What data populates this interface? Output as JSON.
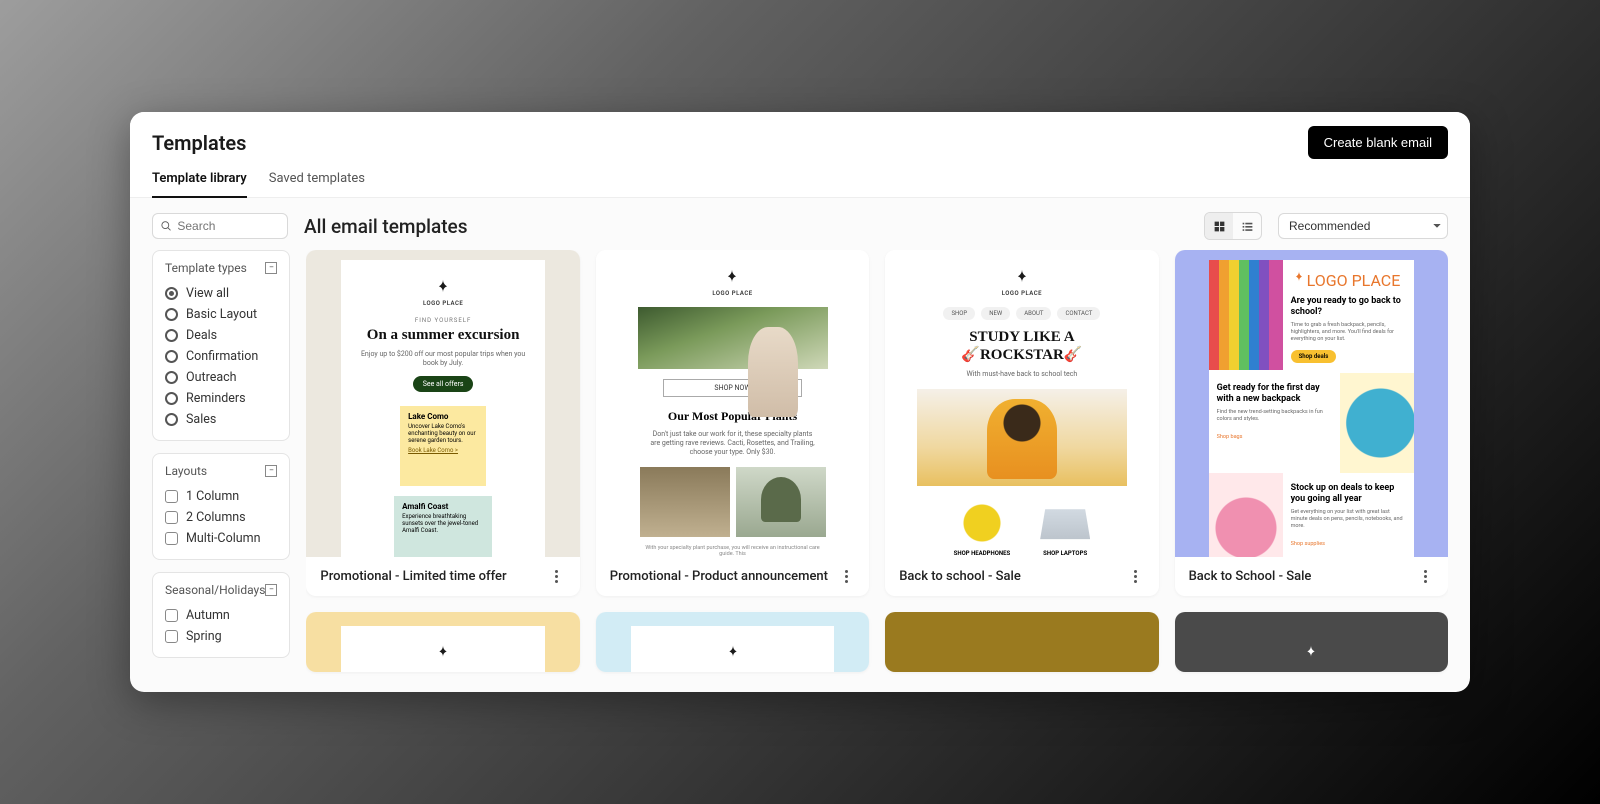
{
  "header": {
    "title": "Templates",
    "create_button": "Create blank email"
  },
  "tabs": [
    "Template library",
    "Saved templates"
  ],
  "active_tab": 0,
  "search": {
    "placeholder": "Search"
  },
  "heading": "All email templates",
  "view_mode": "grid",
  "sort": {
    "selected": "Recommended"
  },
  "filters": {
    "types": {
      "title": "Template types",
      "options": [
        "View all",
        "Basic Layout",
        "Deals",
        "Confirmation",
        "Outreach",
        "Reminders",
        "Sales"
      ],
      "selected": "View all"
    },
    "layouts": {
      "title": "Layouts",
      "options": [
        "1 Column",
        "2 Columns",
        "Multi-Column"
      ]
    },
    "seasonal": {
      "title": "Seasonal/Holidays",
      "options": [
        "Autumn",
        "Spring"
      ]
    }
  },
  "logo_text": "LOGO PLACE",
  "cards": [
    {
      "title": "Promotional - Limited time offer",
      "tag": "FIND YOURSELF",
      "headline": "On a summer excursion",
      "sub": "Enjoy up to $200 off our most popular trips when you book by July.",
      "cta": "See all offers",
      "feat1_title": "Lake Como",
      "feat1_body": "Uncover Lake Como's enchanting beauty on our serene garden tours.",
      "feat1_link": "Book Lake Como  >",
      "feat2_title": "Amalfi Coast",
      "feat2_body": "Experience breathtaking sunsets over the jewel-toned Amalfi Coast."
    },
    {
      "title": "Promotional - Product announcement",
      "cta": "SHOP NOW",
      "headline2": "Our Most Popular Plants",
      "sub2": "Don't just take our work for it, these specialty plants are getting rave reviews. Cacti, Rosettes, and Trailing, choose your type. Only $30.",
      "foot": "With your specialty plant purchase, you will receive an instructional care guide. This"
    },
    {
      "title": "Back to school - Sale",
      "nav": [
        "SHOP",
        "NEW",
        "ABOUT",
        "CONTACT"
      ],
      "headline3a": "STUDY LIKE A",
      "headline3b": "ROCKSTAR",
      "sub3": "With must-have back to school tech",
      "prod1": "SHOP HEADPHONES",
      "prod2": "SHOP LAPTOPS"
    },
    {
      "title": "Back to School - Sale",
      "block1_h": "Are you ready to go back to school?",
      "block1_p": "Time to grab a fresh backpack, pencils, highlighters, and more. You'll find deals for everything on your list.",
      "block1_btn": "Shop deals",
      "block2_h": "Get ready for the first day with a new backpack",
      "block2_p": "Find the new trend-setting backpacks in fun colors and styles.",
      "block2_link": "Shop bags",
      "block3_h": "Stock up on deals to keep you going all year",
      "block3_p": "Get everything on your list with great last minute deals on pens, pencils, notebooks, and more.",
      "block3_link": "Shop supplies"
    }
  ]
}
